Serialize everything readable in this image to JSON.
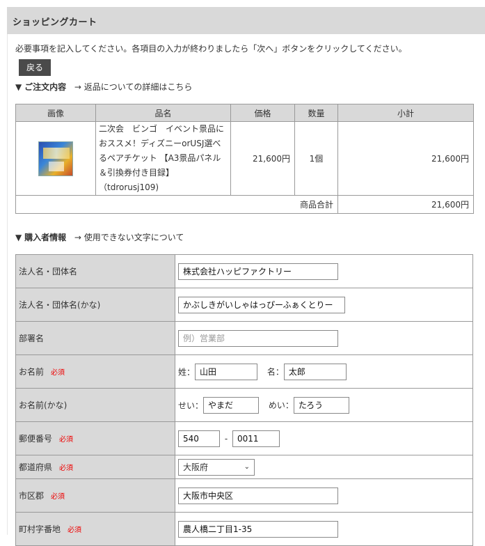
{
  "header": {
    "title": "ショッピングカート"
  },
  "intro": "必要事項を記入してください。各項目の入力が終わりましたら「次へ」ボタンをクリックしてください。",
  "back_label": "戻る",
  "order_section": {
    "marker": "▼",
    "title": "ご注文内容",
    "link": "→ 返品についての詳細はこちら"
  },
  "order_table": {
    "headers": [
      "画像",
      "品名",
      "価格",
      "数量",
      "小計"
    ],
    "items": [
      {
        "name": "二次会　ビンゴ　イベント景品におススメ！ディズニーorUSJ選べるペアチケット 【A3景品パネル＆引換券付き目録】（tdrorusj109)",
        "price": "21,600円",
        "qty": "1個",
        "subtotal": "21,600円"
      }
    ],
    "total_label": "商品合計",
    "total_value": "21,600円"
  },
  "buyer_section": {
    "marker": "▼",
    "title": "購入者情報",
    "link": "→ 使用できない文字について"
  },
  "required_label": "必須",
  "form": {
    "company": {
      "label": "法人名・団体名",
      "value": "株式会社ハッピファクトリー"
    },
    "company_kana": {
      "label": "法人名・団体名(かな)",
      "value": "かぶしきがいしゃはっぴーふぁくとりー"
    },
    "department": {
      "label": "部署名",
      "value": "",
      "placeholder": "例）営業部"
    },
    "name": {
      "label": "お名前",
      "last_label": "姓：",
      "last_value": "山田",
      "first_label": "名：",
      "first_value": "太郎"
    },
    "name_kana": {
      "label": "お名前(かな)",
      "last_label": "せい：",
      "last_value": "やまだ",
      "first_label": "めい：",
      "first_value": "たろう"
    },
    "postal": {
      "label": "郵便番号",
      "part1": "540",
      "sep": "-",
      "part2": "0011"
    },
    "prefecture": {
      "label": "都道府県",
      "value": "大阪府"
    },
    "city": {
      "label": "市区郡",
      "value": "大阪市中央区"
    },
    "street": {
      "label": "町村字番地",
      "value": "農人橋二丁目1-35"
    }
  }
}
